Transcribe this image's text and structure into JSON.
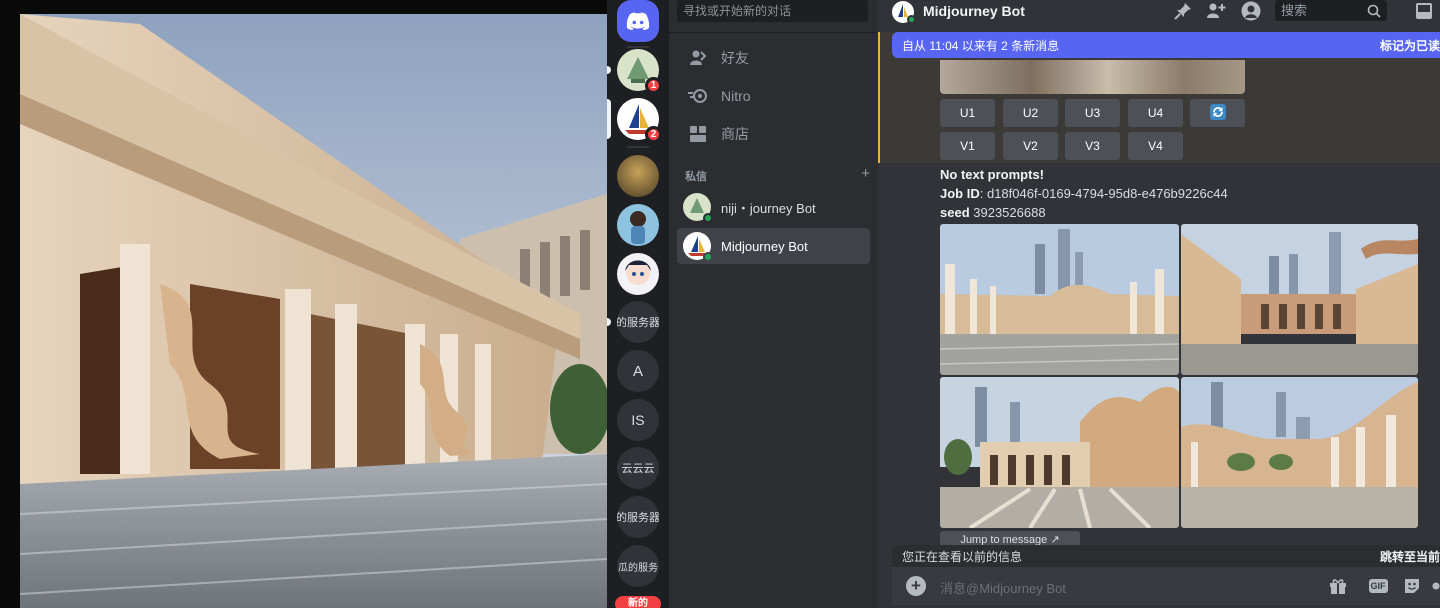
{
  "dm_sidebar": {
    "search_placeholder": "寻找或开始新的对话",
    "nav": [
      {
        "label": "好友",
        "icon": "friends-icon"
      },
      {
        "label": "Nitro",
        "icon": "nitro-icon"
      },
      {
        "label": "商店",
        "icon": "shop-icon"
      }
    ],
    "section_title": "私信",
    "add_icon": "plus-icon",
    "dms": [
      {
        "name": "niji・journey Bot",
        "status": "online"
      },
      {
        "name": "Midjourney Bot",
        "status": "online",
        "active": true
      }
    ]
  },
  "server_rail": {
    "home_icon": "discord-logo-icon",
    "servers": [
      {
        "badge": "1"
      },
      {
        "badge": "2"
      },
      {
        "label": ""
      },
      {
        "label": ""
      },
      {
        "label": ""
      },
      {
        "label": "的服务器"
      },
      {
        "label": "A"
      },
      {
        "label": "IS"
      },
      {
        "label": "云云云"
      },
      {
        "label": "的服务器"
      },
      {
        "label": "瓜的服务"
      }
    ],
    "new_label": "新的"
  },
  "chat": {
    "title": "Midjourney Bot",
    "search_placeholder": "搜索",
    "unread_text": "自从 11:04 以来有 2 条新消息",
    "unread_action": "标记为已读",
    "buttons_row1": [
      "U1",
      "U2",
      "U3",
      "U4"
    ],
    "buttons_row2": [
      "V1",
      "V2",
      "V3",
      "V4"
    ],
    "prompt_line": "No text prompts!",
    "job_label": "Job ID",
    "job_id": ": d18f046f-0169-4794-95d8-e476b9226c44",
    "seed_label": "seed",
    "seed_value": " 3923526688",
    "jump_button": "Jump to message",
    "old_notice": "您正在查看以前的信息",
    "old_action": "跳转至当前",
    "input_placeholder": "消息@Midjourney Bot",
    "input_icons": [
      "gift-icon",
      "gif-icon",
      "sticker-icon",
      "emoji-icon"
    ],
    "gif_label": "GIF"
  }
}
